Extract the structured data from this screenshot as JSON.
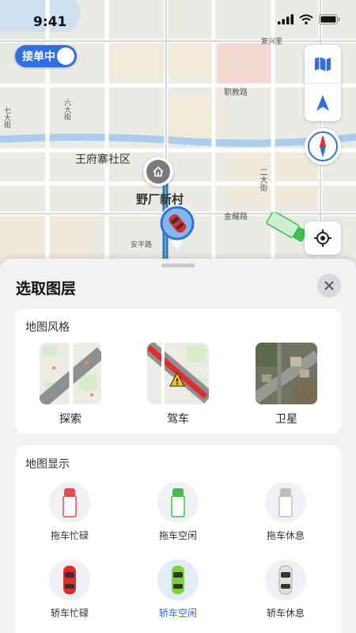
{
  "status_bar": {
    "time": "9:41"
  },
  "map": {
    "toggle_label": "接单中",
    "labels": {
      "fuxing": "复兴里",
      "zhiye": "职教路",
      "qida": "七大街",
      "liuda": "六大街",
      "wangfu": "王府寨社区",
      "yechang": "野厂新村",
      "erda": "二大街",
      "jinhui": "金耀路",
      "anping": "安平路"
    },
    "compass_north": "北"
  },
  "sheet": {
    "title": "选取图层",
    "map_style": {
      "title": "地图风格",
      "items": [
        {
          "label": "探索"
        },
        {
          "label": "驾车"
        },
        {
          "label": "卫星"
        }
      ]
    },
    "map_display": {
      "title": "地图显示",
      "items": [
        {
          "label": "拖车忙碌",
          "color": "#e84848"
        },
        {
          "label": "拖车空闲",
          "color": "#3cc24a"
        },
        {
          "label": "拖车休息",
          "color": "#bdbdbd"
        },
        {
          "label": "轿车忙碌",
          "color": "#e22b2b"
        },
        {
          "label": "轿车空闲",
          "color": "#7bd33a"
        },
        {
          "label": "轿车休息",
          "color": "#d8d8d8"
        }
      ],
      "active_index": 4
    }
  },
  "colors": {
    "accent": "#2f6fe6"
  }
}
